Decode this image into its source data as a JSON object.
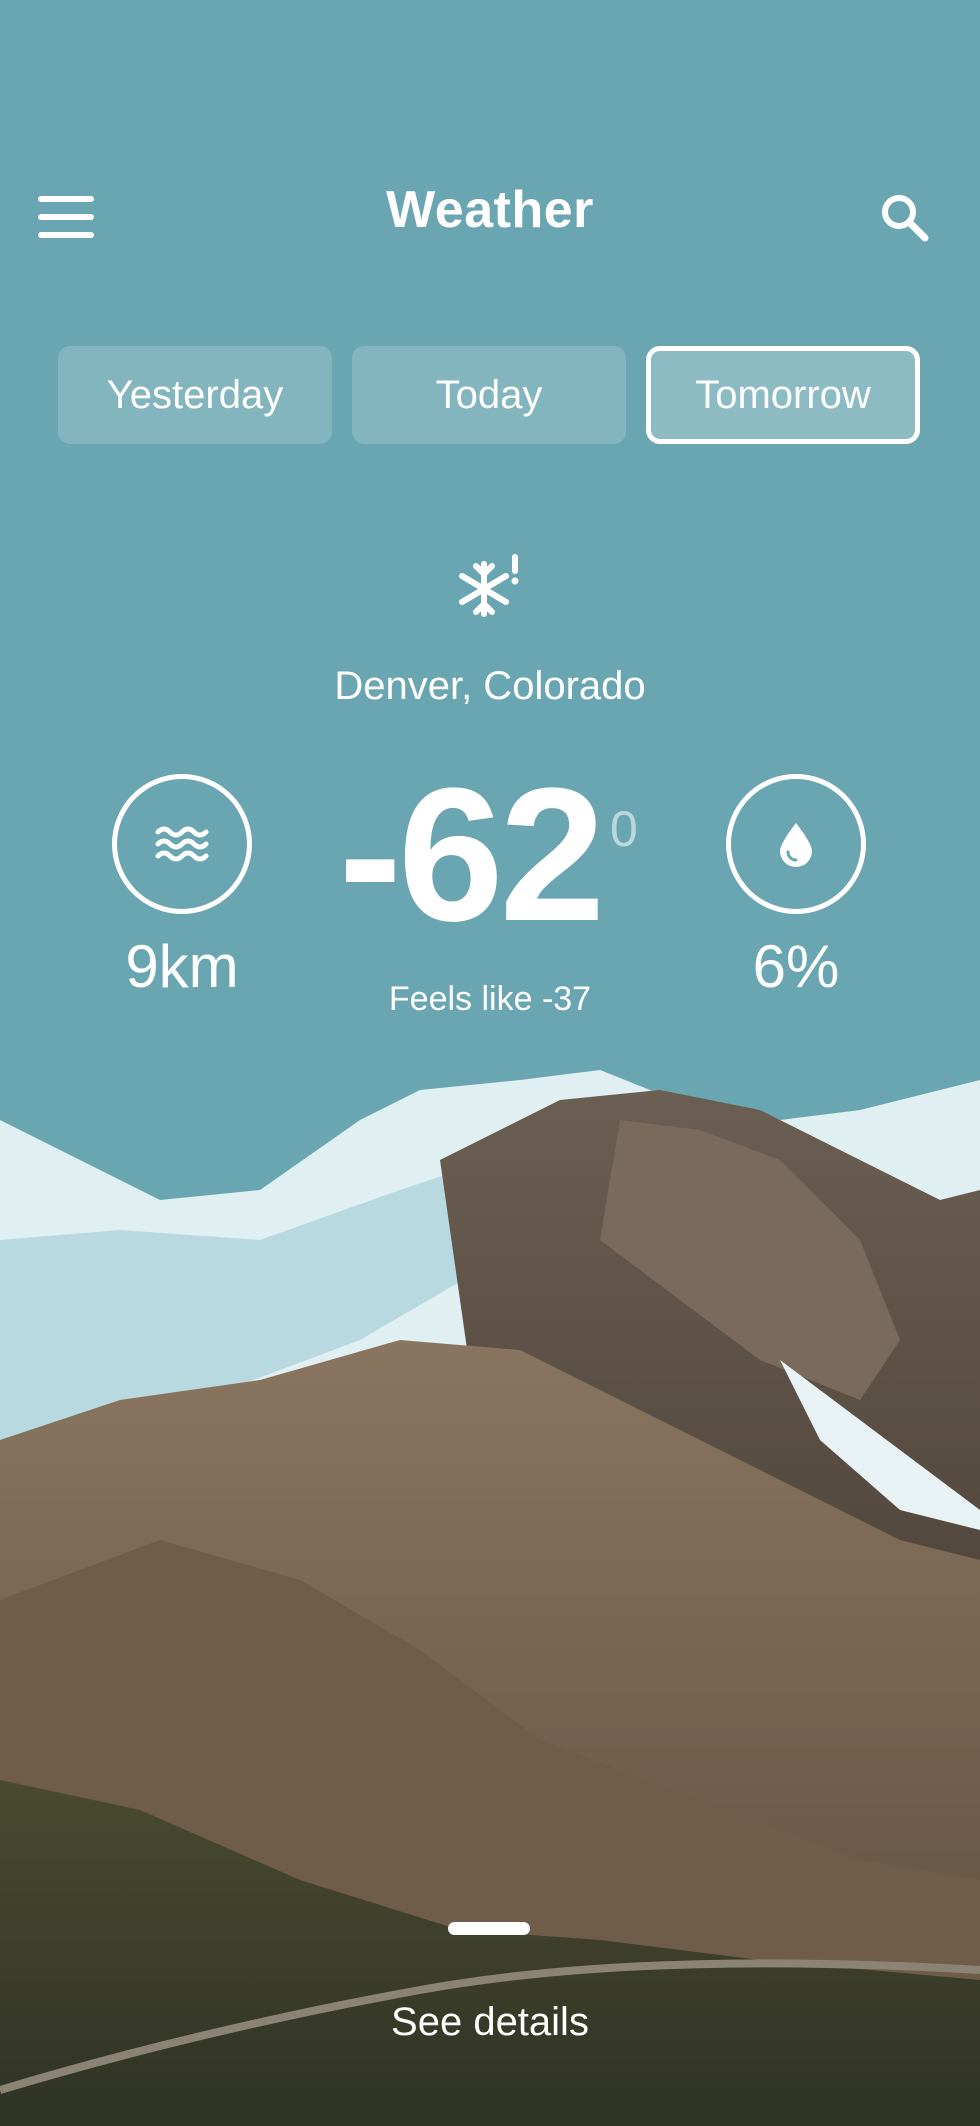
{
  "header": {
    "title": "Weather",
    "menu_icon": "hamburger-menu-icon",
    "search_icon": "search-icon"
  },
  "tabs": [
    {
      "label": "Yesterday",
      "active": false
    },
    {
      "label": "Today",
      "active": false
    },
    {
      "label": "Tomorrow",
      "active": true
    }
  ],
  "current": {
    "condition_icon": "snowflake-warning-icon",
    "location": "Denver, Colorado",
    "temperature": "-62",
    "degree_symbol": "0",
    "feels_like": "Feels like -37"
  },
  "stats": {
    "visibility": {
      "icon": "wind-waves-icon",
      "value": "9km"
    },
    "humidity": {
      "icon": "water-drop-icon",
      "value": "6%"
    }
  },
  "footer": {
    "see_details": "See details"
  },
  "colors": {
    "background": "#6aa6b1",
    "text": "#ffffff"
  }
}
